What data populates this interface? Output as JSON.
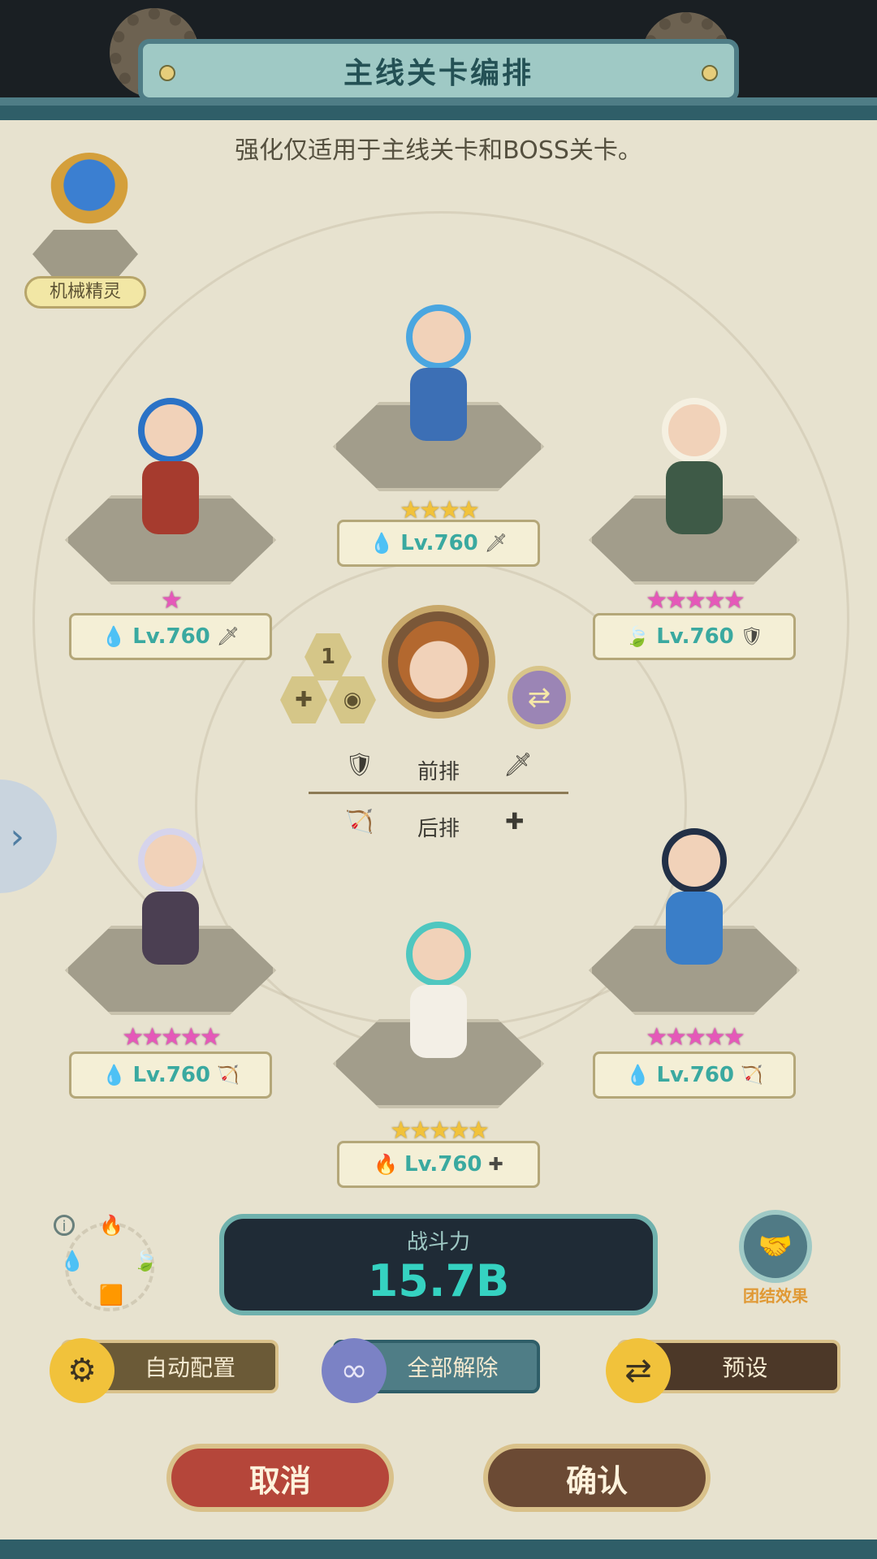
{
  "header": {
    "title": "主线关卡编排"
  },
  "notice": "强化仅适用于主线关卡和BOSS关卡。",
  "spirit": {
    "label": "机械精灵"
  },
  "heroes": [
    {
      "slot": "front-left",
      "stars": "★",
      "star_color": "pink",
      "element_icon": "💧",
      "level": "Lv.760",
      "role_icon": "🗡"
    },
    {
      "slot": "front-center",
      "stars": "★★★★",
      "star_color": "gold",
      "element_icon": "💧",
      "level": "Lv.760",
      "role_icon": "🗡"
    },
    {
      "slot": "front-right",
      "stars": "★★★★★",
      "star_color": "pink",
      "element_icon": "🍃",
      "level": "Lv.760",
      "role_icon": "🛡"
    },
    {
      "slot": "back-left",
      "stars": "★★★★★",
      "star_color": "pink",
      "element_icon": "💧",
      "level": "Lv.760",
      "role_icon": "🏹"
    },
    {
      "slot": "back-center",
      "stars": "★★★★★",
      "star_color": "gold",
      "element_icon": "🔥",
      "level": "Lv.760",
      "role_icon": "✚"
    },
    {
      "slot": "back-right",
      "stars": "★★★★★",
      "star_color": "pink",
      "element_icon": "💧",
      "level": "Lv.760",
      "role_icon": "🏹"
    }
  ],
  "leader": {
    "slot_number": "1"
  },
  "rows": {
    "front": "前排",
    "back": "后排",
    "front_icon_left": "🛡",
    "front_icon_right": "🗡",
    "back_icon_left": "🏹",
    "back_icon_right": "✚"
  },
  "power": {
    "label": "战斗力",
    "value": "15.7B"
  },
  "synergy": {
    "label": "团结效果"
  },
  "actions": {
    "auto": "自动配置",
    "clear": "全部解除",
    "preset": "预设"
  },
  "buttons": {
    "cancel": "取消",
    "confirm": "确认"
  },
  "colors": {
    "teal": "#4f7d86",
    "power_text": "#35d2c1",
    "cancel_red": "#b5463a",
    "confirm_brown": "#6b4a34"
  }
}
